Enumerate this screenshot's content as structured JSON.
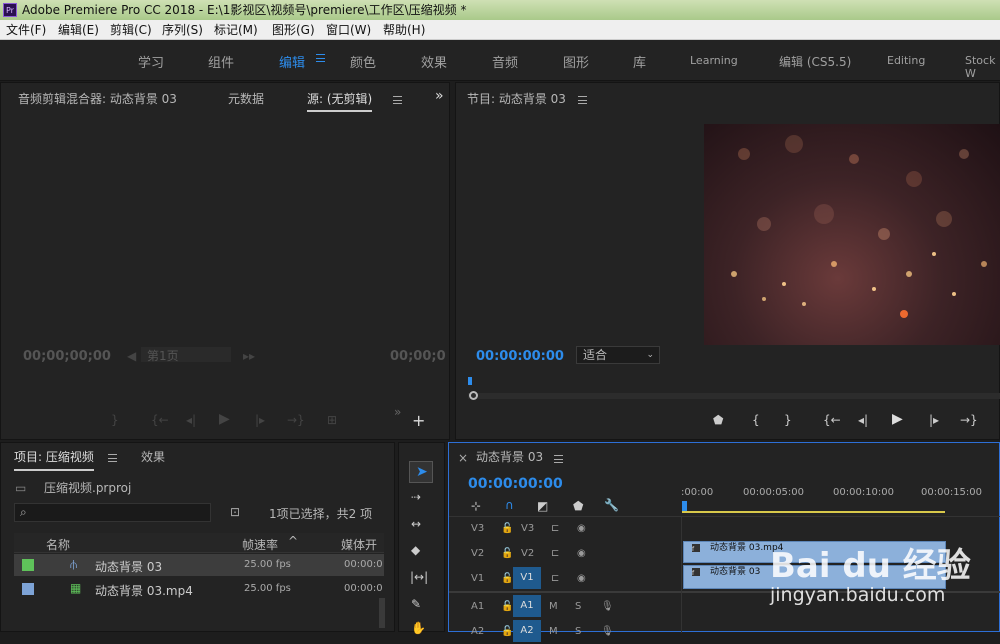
{
  "title": {
    "app": "Adobe Premiere Pro CC 2018 - E:\\1影视区\\视频号\\premiere\\工作区\\压缩视频 *",
    "logo": "Pr"
  },
  "menu": [
    "文件(F)",
    "编辑(E)",
    "剪辑(C)",
    "序列(S)",
    "标记(M)",
    "图形(G)",
    "窗口(W)",
    "帮助(H)"
  ],
  "workspaces": [
    "学习",
    "组件",
    "编辑",
    "颜色",
    "效果",
    "音频",
    "图形",
    "库",
    "Learning",
    "编辑 (CS5.5)",
    "Editing",
    "Stock W"
  ],
  "source": {
    "tabs": [
      "音频剪辑混合器: 动态背景 03",
      "元数据",
      "源: (无剪辑)"
    ],
    "tc_left": "00;00;00;00",
    "page": "第1页",
    "tc_right": "00;00;0",
    "more": "»"
  },
  "program": {
    "title": "节目: 动态背景 03",
    "timecode": "00:00:00:00",
    "fit": "适合"
  },
  "project": {
    "tabs": [
      "项目: 压缩视频",
      "效果"
    ],
    "file": "压缩视频.prproj",
    "selection": "1项已选择，共2 项",
    "columns": [
      "名称",
      "帧速率",
      "媒体开"
    ],
    "rows": [
      {
        "name": "动态背景 03",
        "fps": "25.00 fps",
        "start": "00:00:0",
        "color": "#5fc25a"
      },
      {
        "name": "动态背景 03.mp4",
        "fps": "25.00 fps",
        "start": "00:00:0",
        "color": "#7da3d6"
      }
    ]
  },
  "timeline": {
    "title": "动态背景 03",
    "timecode": "00:00:00:00",
    "ruler": [
      ":00:00",
      "00:00:05:00",
      "00:00:10:00",
      "00:00:15:00"
    ],
    "tracks": [
      {
        "a": "V3",
        "b": "V3"
      },
      {
        "a": "V2",
        "b": "V2"
      },
      {
        "a": "V1",
        "b": "V1"
      },
      {
        "a": "A1",
        "b": "A1"
      },
      {
        "a": "A2",
        "b": "A2"
      }
    ],
    "clip_v2": "动态背景 03.mp4",
    "clip_v1": "动态背景 03"
  },
  "watermark": {
    "brand": "Bai du 经验",
    "url": "jingyan.baidu.com"
  },
  "colors": {
    "accent": "#2d8ceb",
    "timeline_border": "#2d6fd6"
  }
}
